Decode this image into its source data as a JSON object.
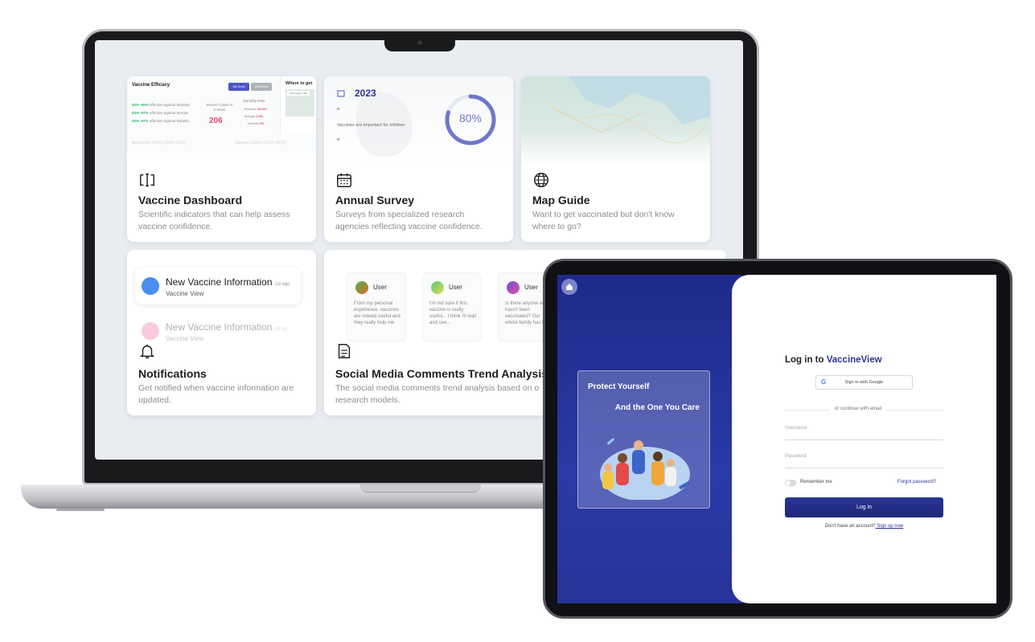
{
  "dashboard": {
    "efficacy": {
      "title": "Vaccine Efficacy",
      "tab1": "1st Dose",
      "tab2": "2nd Dose",
      "line1_pct": "80%~95%",
      "line1_text": "effective against Measles",
      "line2_pct": "63%~97%",
      "line2_text": "effective against Mumps",
      "line3_pct": "50%~97%",
      "line3_text": "effective against Rubella",
      "severe_label": "Severe Cases in 5 Years",
      "severe_value": "206",
      "mortality_label": "Mortality Rate",
      "mort1": "Measles",
      "mort1_val": "18.6%",
      "mort2": "Mumps",
      "mort2_val": "1.8%",
      "mort3": "Rubella",
      "mort3_val": "0%",
      "footer1": "Antibodies Rates (2019~2022)",
      "footer2": "Disease Cases (2019~2022)",
      "where_title": "Where to get",
      "where_btn": "View larger map"
    },
    "survey": {
      "year": "2023",
      "quote_open": "“",
      "quote": "Vaccines are important for children",
      "quote_close": "“",
      "percent": "80%",
      "progress": 0.8
    },
    "cards": [
      {
        "title": "Vaccine Dashboard",
        "desc": "Scientific indicators that can help assess vaccine confidence."
      },
      {
        "title": "Annual Survey",
        "desc": "Surveys from specialized research agencies reflecting vaccine confidence."
      },
      {
        "title": "Map Guide",
        "desc": "Want to get vaccinated but don't know where to go?"
      },
      {
        "title": "Notifications",
        "desc": "Get notified when vaccine information are updated."
      },
      {
        "title": "Social Media Comments Trend Analysis",
        "desc": "The social media comments trend analysis based on o research models."
      }
    ],
    "notifications": [
      {
        "title": "New Vaccine Information",
        "time": "· 1d ago",
        "sub": "Vaccine View"
      },
      {
        "title": "New Vaccine Information",
        "time": "· 3d ag",
        "sub": "Vaccine View"
      }
    ],
    "comments": [
      {
        "user": "User",
        "text": "From my personal experience, vaccines are indeed useful and they really help me"
      },
      {
        "user": "User",
        "text": "I'm not sure if this vaccine is really useful... I think I'll wait and see..."
      },
      {
        "user": "User",
        "text": "Is there anyone who hasn't been vaccinated? Our whole family has been"
      }
    ]
  },
  "login": {
    "promo_line1": "Protect Yourself",
    "promo_line2": "And the One You Care",
    "heading_prefix": "Log in to ",
    "heading_brand": "VaccineView",
    "google_btn": "Sign in with Google",
    "divider": "or continue with email",
    "username_placeholder": "Username",
    "password_placeholder": "Password",
    "remember": "Remember me",
    "forgot": "Forgot password?",
    "login_btn": "Log in",
    "signup_prompt": "Don't have an account?",
    "signup_link": " Sign up now"
  },
  "colors": {
    "brand": "#2b3596",
    "accent_green": "#3bb56b",
    "accent_pink": "#e0457b"
  }
}
